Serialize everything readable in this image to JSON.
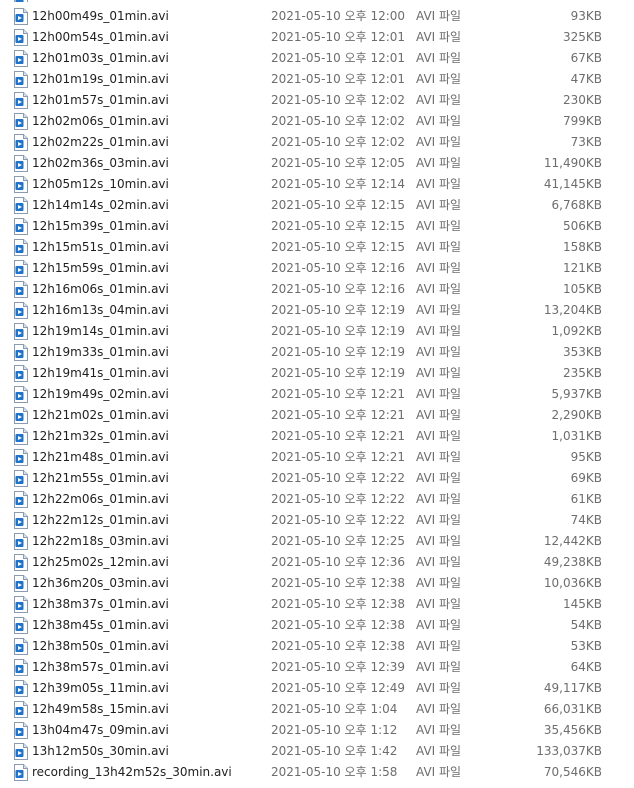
{
  "files": [
    {
      "name": "12h00m49s_01min.avi",
      "date": "2021-05-10 오후 12:00",
      "type": "AVI 파일",
      "size": "93KB"
    },
    {
      "name": "12h00m54s_01min.avi",
      "date": "2021-05-10 오후 12:01",
      "type": "AVI 파일",
      "size": "325KB"
    },
    {
      "name": "12h01m03s_01min.avi",
      "date": "2021-05-10 오후 12:01",
      "type": "AVI 파일",
      "size": "67KB"
    },
    {
      "name": "12h01m19s_01min.avi",
      "date": "2021-05-10 오후 12:01",
      "type": "AVI 파일",
      "size": "47KB"
    },
    {
      "name": "12h01m57s_01min.avi",
      "date": "2021-05-10 오후 12:02",
      "type": "AVI 파일",
      "size": "230KB"
    },
    {
      "name": "12h02m06s_01min.avi",
      "date": "2021-05-10 오후 12:02",
      "type": "AVI 파일",
      "size": "799KB"
    },
    {
      "name": "12h02m22s_01min.avi",
      "date": "2021-05-10 오후 12:02",
      "type": "AVI 파일",
      "size": "73KB"
    },
    {
      "name": "12h02m36s_03min.avi",
      "date": "2021-05-10 오후 12:05",
      "type": "AVI 파일",
      "size": "11,490KB"
    },
    {
      "name": "12h05m12s_10min.avi",
      "date": "2021-05-10 오후 12:14",
      "type": "AVI 파일",
      "size": "41,145KB"
    },
    {
      "name": "12h14m14s_02min.avi",
      "date": "2021-05-10 오후 12:15",
      "type": "AVI 파일",
      "size": "6,768KB"
    },
    {
      "name": "12h15m39s_01min.avi",
      "date": "2021-05-10 오후 12:15",
      "type": "AVI 파일",
      "size": "506KB"
    },
    {
      "name": "12h15m51s_01min.avi",
      "date": "2021-05-10 오후 12:15",
      "type": "AVI 파일",
      "size": "158KB"
    },
    {
      "name": "12h15m59s_01min.avi",
      "date": "2021-05-10 오후 12:16",
      "type": "AVI 파일",
      "size": "121KB"
    },
    {
      "name": "12h16m06s_01min.avi",
      "date": "2021-05-10 오후 12:16",
      "type": "AVI 파일",
      "size": "105KB"
    },
    {
      "name": "12h16m13s_04min.avi",
      "date": "2021-05-10 오후 12:19",
      "type": "AVI 파일",
      "size": "13,204KB"
    },
    {
      "name": "12h19m14s_01min.avi",
      "date": "2021-05-10 오후 12:19",
      "type": "AVI 파일",
      "size": "1,092KB"
    },
    {
      "name": "12h19m33s_01min.avi",
      "date": "2021-05-10 오후 12:19",
      "type": "AVI 파일",
      "size": "353KB"
    },
    {
      "name": "12h19m41s_01min.avi",
      "date": "2021-05-10 오후 12:19",
      "type": "AVI 파일",
      "size": "235KB"
    },
    {
      "name": "12h19m49s_02min.avi",
      "date": "2021-05-10 오후 12:21",
      "type": "AVI 파일",
      "size": "5,937KB"
    },
    {
      "name": "12h21m02s_01min.avi",
      "date": "2021-05-10 오후 12:21",
      "type": "AVI 파일",
      "size": "2,290KB"
    },
    {
      "name": "12h21m32s_01min.avi",
      "date": "2021-05-10 오후 12:21",
      "type": "AVI 파일",
      "size": "1,031KB"
    },
    {
      "name": "12h21m48s_01min.avi",
      "date": "2021-05-10 오후 12:21",
      "type": "AVI 파일",
      "size": "95KB"
    },
    {
      "name": "12h21m55s_01min.avi",
      "date": "2021-05-10 오후 12:22",
      "type": "AVI 파일",
      "size": "69KB"
    },
    {
      "name": "12h22m06s_01min.avi",
      "date": "2021-05-10 오후 12:22",
      "type": "AVI 파일",
      "size": "61KB"
    },
    {
      "name": "12h22m12s_01min.avi",
      "date": "2021-05-10 오후 12:22",
      "type": "AVI 파일",
      "size": "74KB"
    },
    {
      "name": "12h22m18s_03min.avi",
      "date": "2021-05-10 오후 12:25",
      "type": "AVI 파일",
      "size": "12,442KB"
    },
    {
      "name": "12h25m02s_12min.avi",
      "date": "2021-05-10 오후 12:36",
      "type": "AVI 파일",
      "size": "49,238KB"
    },
    {
      "name": "12h36m20s_03min.avi",
      "date": "2021-05-10 오후 12:38",
      "type": "AVI 파일",
      "size": "10,036KB"
    },
    {
      "name": "12h38m37s_01min.avi",
      "date": "2021-05-10 오후 12:38",
      "type": "AVI 파일",
      "size": "145KB"
    },
    {
      "name": "12h38m45s_01min.avi",
      "date": "2021-05-10 오후 12:38",
      "type": "AVI 파일",
      "size": "54KB"
    },
    {
      "name": "12h38m50s_01min.avi",
      "date": "2021-05-10 오후 12:38",
      "type": "AVI 파일",
      "size": "53KB"
    },
    {
      "name": "12h38m57s_01min.avi",
      "date": "2021-05-10 오후 12:39",
      "type": "AVI 파일",
      "size": "64KB"
    },
    {
      "name": "12h39m05s_11min.avi",
      "date": "2021-05-10 오후 12:49",
      "type": "AVI 파일",
      "size": "49,117KB"
    },
    {
      "name": "12h49m58s_15min.avi",
      "date": "2021-05-10 오후 1:04",
      "type": "AVI 파일",
      "size": "66,031KB"
    },
    {
      "name": "13h04m47s_09min.avi",
      "date": "2021-05-10 오후 1:12",
      "type": "AVI 파일",
      "size": "35,456KB"
    },
    {
      "name": "13h12m50s_30min.avi",
      "date": "2021-05-10 오후 1:42",
      "type": "AVI 파일",
      "size": "133,037KB"
    },
    {
      "name": "recording_13h42m52s_30min.avi",
      "date": "2021-05-10 오후 1:58",
      "type": "AVI 파일",
      "size": "70,546KB"
    }
  ],
  "icon": "video-file-icon",
  "colors": {
    "icon_page": "#ffffff",
    "icon_border": "#8a9bb0",
    "icon_fold": "#d8e2ee",
    "icon_badge": "#1f74c9",
    "text": "#1f1f1f",
    "meta_text": "#6d6d6d"
  }
}
